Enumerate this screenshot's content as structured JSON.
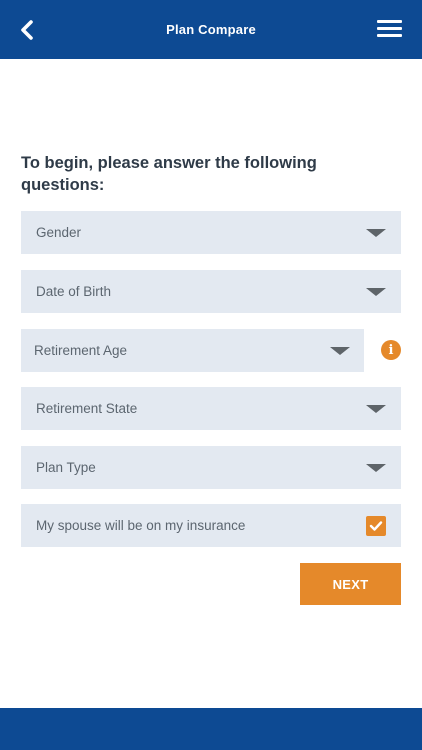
{
  "header": {
    "title": "Plan Compare",
    "back_icon": "chevron-left-icon",
    "menu_icon": "hamburger-menu-icon"
  },
  "intro": {
    "text": "To begin, please answer the following questions:"
  },
  "form": {
    "gender": {
      "label": "Gender"
    },
    "date_of_birth": {
      "label": "Date of Birth"
    },
    "retirement_age": {
      "label": "Retirement Age",
      "info_icon": "info-icon"
    },
    "retirement_state": {
      "label": "Retirement State"
    },
    "plan_type": {
      "label": "Plan Type"
    },
    "spouse": {
      "label": "My spouse will be on my insurance",
      "checked": true
    }
  },
  "actions": {
    "next_label": "NEXT"
  },
  "colors": {
    "brand_blue": "#0d4a93",
    "accent_orange": "#e5892a",
    "field_bg": "#e3e9f1"
  }
}
